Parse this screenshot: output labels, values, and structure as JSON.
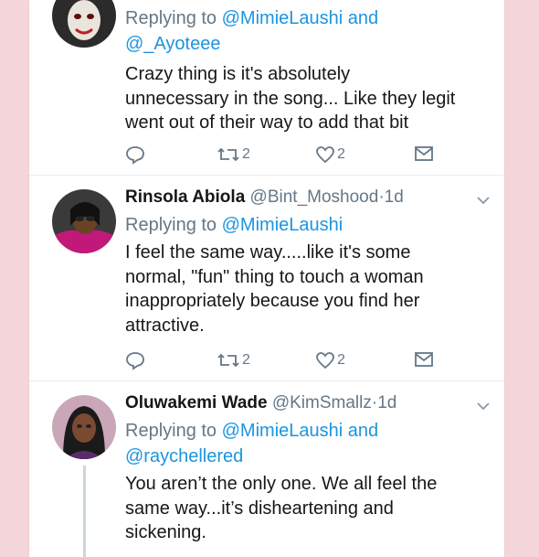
{
  "tweets": [
    {
      "reply_label": "Replying to",
      "mentions": [
        "@MimieLaushi",
        "@_Ayoteee"
      ],
      "and": "and",
      "text_lines": [
        "Crazy thing is it's absolutely",
        "unnecessary in the song... Like they legit",
        "went out of their way to add that bit"
      ],
      "retweets": "2",
      "likes": "2"
    },
    {
      "name": "Rinsola Abiola",
      "handle": "@Bint_Moshood",
      "sep": "·",
      "time": "1d",
      "reply_label": "Replying to",
      "mentions": [
        "@MimieLaushi"
      ],
      "text_lines": [
        "I feel the same way.....like it's some",
        "normal, \"fun\" thing to touch a woman",
        "inappropriately because you find her",
        "attractive."
      ],
      "retweets": "2",
      "likes": "2"
    },
    {
      "name": "Oluwakemi Wade",
      "handle": "@KimSmallz",
      "sep": "·",
      "time": "1d",
      "reply_label": "Replying to",
      "mentions": [
        "@MimieLaushi",
        "@raychellered"
      ],
      "and": "and",
      "text_lines": [
        "You aren’t the only one. We all feel the",
        "same way...it’s disheartening and",
        "sickening."
      ]
    }
  ],
  "icons": {
    "reply": "reply-icon",
    "retweet": "retweet-icon",
    "like": "heart-icon",
    "dm": "envelope-icon",
    "more": "chevron-down-icon"
  },
  "colors": {
    "background": "#f4d6da",
    "link": "#1b95e0",
    "muted": "#657786",
    "text": "#14171a"
  }
}
